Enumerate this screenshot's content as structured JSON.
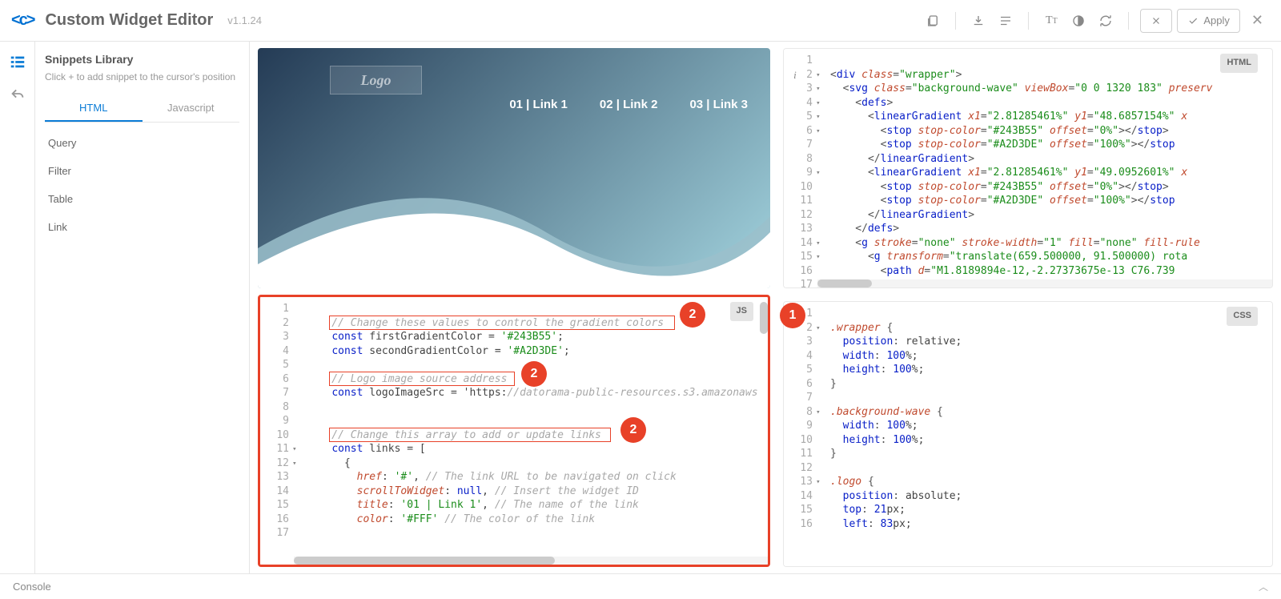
{
  "header": {
    "title": "Custom Widget Editor",
    "version": "v1.1.24",
    "apply_label": "Apply"
  },
  "sidebar": {
    "title": "Snippets Library",
    "subtitle": "Click + to add snippet to the cursor's position",
    "tabs": [
      {
        "label": "HTML",
        "active": true
      },
      {
        "label": "Javascript",
        "active": false
      }
    ],
    "items": [
      "Query",
      "Filter",
      "Table",
      "Link"
    ]
  },
  "preview": {
    "logo_text": "Logo",
    "links": [
      "01 | Link 1",
      "02 | Link 2",
      "03 | Link 3"
    ],
    "gradient_colors": [
      "#243B55",
      "#A2D3DE"
    ]
  },
  "js_editor": {
    "badge": "JS",
    "line_start": 1,
    "line_end": 17,
    "fold_lines": [
      11,
      12
    ],
    "lines": [
      "",
      "    // Change these values to control the gradient colors",
      "    const firstGradientColor = '#243B55';",
      "    const secondGradientColor = '#A2D3DE';",
      "",
      "    // Logo image source address",
      "    const logoImageSrc = 'https://datorama-public-resources.s3.amazonaws",
      "",
      "",
      "    // Change this array to add or update links",
      "    const links = [",
      "      {",
      "        href: '#', // The link URL to be navigated on click",
      "        scrollToWidget: null, // Insert the widget ID",
      "        title: '01 | Link 1', // The name of the link",
      "        color: '#FFF' // The color of the link",
      ""
    ],
    "highlights": [
      {
        "line": 2,
        "text": "// Change these values to control the gradient colors"
      },
      {
        "line": 6,
        "text": "// Logo image source address"
      },
      {
        "line": 10,
        "text": "// Change this array to add or update links"
      }
    ]
  },
  "html_editor": {
    "badge": "HTML",
    "line_start": 1,
    "line_end": 17,
    "info_line": 2,
    "fold_lines": [
      2,
      3,
      4,
      5,
      6,
      9,
      14,
      15
    ],
    "lines_tokens": [
      [],
      [
        [
          "pu",
          "<"
        ],
        [
          "tag",
          "div"
        ],
        [
          "pu",
          " "
        ],
        [
          "attr",
          "class"
        ],
        [
          "pu",
          "="
        ],
        [
          "str",
          "\"wrapper\""
        ],
        [
          "pu",
          ">"
        ]
      ],
      [
        [
          "pu",
          "  <"
        ],
        [
          "tag",
          "svg"
        ],
        [
          "pu",
          " "
        ],
        [
          "attr",
          "class"
        ],
        [
          "pu",
          "="
        ],
        [
          "str",
          "\"background-wave\""
        ],
        [
          "pu",
          " "
        ],
        [
          "attr",
          "viewBox"
        ],
        [
          "pu",
          "="
        ],
        [
          "str",
          "\"0 0 1320 183\""
        ],
        [
          "pu",
          " "
        ],
        [
          "attr",
          "preserv"
        ]
      ],
      [
        [
          "pu",
          "    <"
        ],
        [
          "tag",
          "defs"
        ],
        [
          "pu",
          ">"
        ]
      ],
      [
        [
          "pu",
          "      <"
        ],
        [
          "tag",
          "linearGradient"
        ],
        [
          "pu",
          " "
        ],
        [
          "attr",
          "x1"
        ],
        [
          "pu",
          "="
        ],
        [
          "str",
          "\"2.81285461%\""
        ],
        [
          "pu",
          " "
        ],
        [
          "attr",
          "y1"
        ],
        [
          "pu",
          "="
        ],
        [
          "str",
          "\"48.6857154%\""
        ],
        [
          "pu",
          " "
        ],
        [
          "attr",
          "x"
        ]
      ],
      [
        [
          "pu",
          "        <"
        ],
        [
          "tag",
          "stop"
        ],
        [
          "pu",
          " "
        ],
        [
          "attr",
          "stop-color"
        ],
        [
          "pu",
          "="
        ],
        [
          "str",
          "\"#243B55\""
        ],
        [
          "pu",
          " "
        ],
        [
          "attr",
          "offset"
        ],
        [
          "pu",
          "="
        ],
        [
          "str",
          "\"0%\""
        ],
        [
          "pu",
          "></"
        ],
        [
          "tag",
          "stop"
        ],
        [
          "pu",
          ">"
        ]
      ],
      [
        [
          "pu",
          "        <"
        ],
        [
          "tag",
          "stop"
        ],
        [
          "pu",
          " "
        ],
        [
          "attr",
          "stop-color"
        ],
        [
          "pu",
          "="
        ],
        [
          "str",
          "\"#A2D3DE\""
        ],
        [
          "pu",
          " "
        ],
        [
          "attr",
          "offset"
        ],
        [
          "pu",
          "="
        ],
        [
          "str",
          "\"100%\""
        ],
        [
          "pu",
          "></"
        ],
        [
          "tag",
          "stop"
        ]
      ],
      [
        [
          "pu",
          "      </"
        ],
        [
          "tag",
          "linearGradient"
        ],
        [
          "pu",
          ">"
        ]
      ],
      [
        [
          "pu",
          "      <"
        ],
        [
          "tag",
          "linearGradient"
        ],
        [
          "pu",
          " "
        ],
        [
          "attr",
          "x1"
        ],
        [
          "pu",
          "="
        ],
        [
          "str",
          "\"2.81285461%\""
        ],
        [
          "pu",
          " "
        ],
        [
          "attr",
          "y1"
        ],
        [
          "pu",
          "="
        ],
        [
          "str",
          "\"49.0952601%\""
        ],
        [
          "pu",
          " "
        ],
        [
          "attr",
          "x"
        ]
      ],
      [
        [
          "pu",
          "        <"
        ],
        [
          "tag",
          "stop"
        ],
        [
          "pu",
          " "
        ],
        [
          "attr",
          "stop-color"
        ],
        [
          "pu",
          "="
        ],
        [
          "str",
          "\"#243B55\""
        ],
        [
          "pu",
          " "
        ],
        [
          "attr",
          "offset"
        ],
        [
          "pu",
          "="
        ],
        [
          "str",
          "\"0%\""
        ],
        [
          "pu",
          "></"
        ],
        [
          "tag",
          "stop"
        ],
        [
          "pu",
          ">"
        ]
      ],
      [
        [
          "pu",
          "        <"
        ],
        [
          "tag",
          "stop"
        ],
        [
          "pu",
          " "
        ],
        [
          "attr",
          "stop-color"
        ],
        [
          "pu",
          "="
        ],
        [
          "str",
          "\"#A2D3DE\""
        ],
        [
          "pu",
          " "
        ],
        [
          "attr",
          "offset"
        ],
        [
          "pu",
          "="
        ],
        [
          "str",
          "\"100%\""
        ],
        [
          "pu",
          "></"
        ],
        [
          "tag",
          "stop"
        ]
      ],
      [
        [
          "pu",
          "      </"
        ],
        [
          "tag",
          "linearGradient"
        ],
        [
          "pu",
          ">"
        ]
      ],
      [
        [
          "pu",
          "    </"
        ],
        [
          "tag",
          "defs"
        ],
        [
          "pu",
          ">"
        ]
      ],
      [
        [
          "pu",
          "    <"
        ],
        [
          "tag",
          "g"
        ],
        [
          "pu",
          " "
        ],
        [
          "attr",
          "stroke"
        ],
        [
          "pu",
          "="
        ],
        [
          "str",
          "\"none\""
        ],
        [
          "pu",
          " "
        ],
        [
          "attr",
          "stroke-width"
        ],
        [
          "pu",
          "="
        ],
        [
          "str",
          "\"1\""
        ],
        [
          "pu",
          " "
        ],
        [
          "attr",
          "fill"
        ],
        [
          "pu",
          "="
        ],
        [
          "str",
          "\"none\""
        ],
        [
          "pu",
          " "
        ],
        [
          "attr",
          "fill-rule"
        ]
      ],
      [
        [
          "pu",
          "      <"
        ],
        [
          "tag",
          "g"
        ],
        [
          "pu",
          " "
        ],
        [
          "attr",
          "transform"
        ],
        [
          "pu",
          "="
        ],
        [
          "str",
          "\"translate(659.500000, 91.500000) rota"
        ]
      ],
      [
        [
          "pu",
          "        <"
        ],
        [
          "tag",
          "path"
        ],
        [
          "pu",
          " "
        ],
        [
          "attr",
          "d"
        ],
        [
          "pu",
          "="
        ],
        [
          "str",
          "\"M1.8189894e-12,-2.27373675e-13 C76.739"
        ]
      ],
      []
    ]
  },
  "css_editor": {
    "badge": "CSS",
    "line_start": 1,
    "line_end": 16,
    "fold_lines": [
      2,
      8,
      13
    ],
    "lines_tokens": [
      [],
      [
        [
          "sel",
          ".wrapper"
        ],
        [
          "pu",
          " {"
        ]
      ],
      [
        [
          "pu",
          "  "
        ],
        [
          "prop",
          "position"
        ],
        [
          "pu",
          ": "
        ],
        [
          "txt",
          "relative;"
        ]
      ],
      [
        [
          "pu",
          "  "
        ],
        [
          "prop",
          "width"
        ],
        [
          "pu",
          ": "
        ],
        [
          "num",
          "100"
        ],
        [
          "txt",
          "%;"
        ]
      ],
      [
        [
          "pu",
          "  "
        ],
        [
          "prop",
          "height"
        ],
        [
          "pu",
          ": "
        ],
        [
          "num",
          "100"
        ],
        [
          "txt",
          "%;"
        ]
      ],
      [
        [
          "pu",
          "}"
        ]
      ],
      [],
      [
        [
          "sel",
          ".background-wave"
        ],
        [
          "pu",
          " {"
        ]
      ],
      [
        [
          "pu",
          "  "
        ],
        [
          "prop",
          "width"
        ],
        [
          "pu",
          ": "
        ],
        [
          "num",
          "100"
        ],
        [
          "txt",
          "%;"
        ]
      ],
      [
        [
          "pu",
          "  "
        ],
        [
          "prop",
          "height"
        ],
        [
          "pu",
          ": "
        ],
        [
          "num",
          "100"
        ],
        [
          "txt",
          "%;"
        ]
      ],
      [
        [
          "pu",
          "}"
        ]
      ],
      [],
      [
        [
          "sel",
          ".logo"
        ],
        [
          "pu",
          " {"
        ]
      ],
      [
        [
          "pu",
          "  "
        ],
        [
          "prop",
          "position"
        ],
        [
          "pu",
          ": "
        ],
        [
          "txt",
          "absolute;"
        ]
      ],
      [
        [
          "pu",
          "  "
        ],
        [
          "prop",
          "top"
        ],
        [
          "pu",
          ": "
        ],
        [
          "num",
          "21"
        ],
        [
          "txt",
          "px;"
        ]
      ],
      [
        [
          "pu",
          "  "
        ],
        [
          "prop",
          "left"
        ],
        [
          "pu",
          ": "
        ],
        [
          "num",
          "83"
        ],
        [
          "txt",
          "px;"
        ]
      ]
    ]
  },
  "console": {
    "label": "Console"
  },
  "markers": {
    "m1": "1",
    "m2a": "2",
    "m2b": "2",
    "m2c": "2"
  }
}
